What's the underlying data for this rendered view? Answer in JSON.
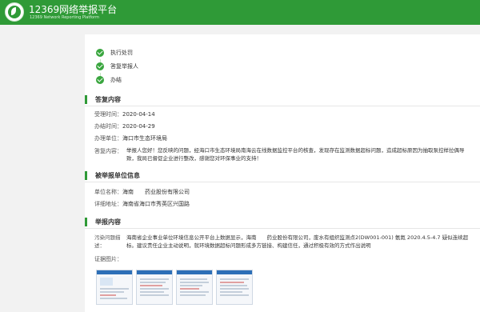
{
  "header": {
    "title": "12369网络举报平台",
    "subtitle": "12369 Network Reporting Platform"
  },
  "steps": [
    {
      "label": "执行处罚"
    },
    {
      "label": "答复举报人"
    },
    {
      "label": "办结"
    }
  ],
  "reply": {
    "title": "答复内容",
    "accept_time_label": "受理时间：",
    "accept_time": "2020-04-14",
    "finish_time_label": "办结时间：",
    "finish_time": "2020-04-29",
    "handler_label": "办理单位：",
    "handler": "海口市生态环境局",
    "content_label": "答复内容：",
    "content": "举报人您好！您反映的问题，经海口市生态环境局南海云在线数据监控平台的核查，发现存在监测数据超标问题，造成超标原因为抽取泵控样拉偶导致，我局已督促企业进行整改，感谢您对环保事业的支持！"
  },
  "reported": {
    "title": "被举报单位信息",
    "name_label": "单位名称：",
    "name": "海南　　药业股份有限公司",
    "address_label": "详细地址：",
    "address": "海南省海口市秀英区兴国路"
  },
  "report": {
    "title": "举报内容",
    "problem_label": "污染问题描述：",
    "problem": "海南省企业事业单位环境信息公开平台上数据显示，海南　　药业股份有限公司，废水有组织监测点2(DW001-001) 氨氮 2020.4.5-4.7 疑似连续超标。建议责任企业主动说明，就环境数据超标问题形成多方链接、构建信任，通过积极有效的方式作出说明",
    "evidence_label": "证据图片："
  },
  "colors": {
    "brand": "#2f9a37",
    "check": "#3aa63f"
  },
  "icons": [
    "logo-icon",
    "check-circle-icon"
  ]
}
